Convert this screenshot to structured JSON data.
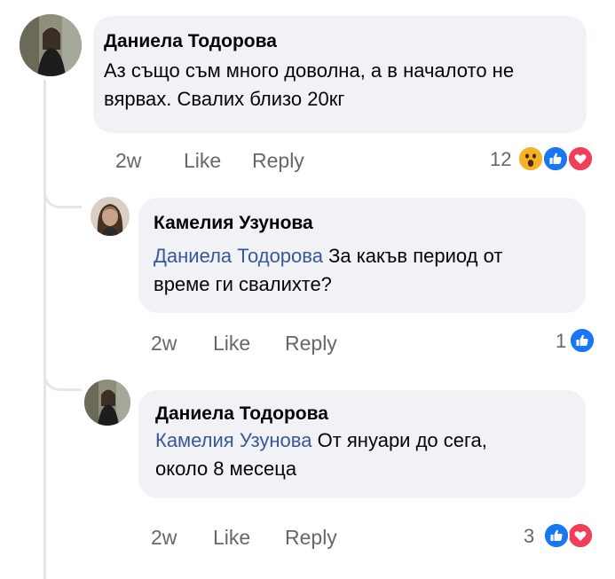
{
  "comments": [
    {
      "author": "Даниела Тодорова",
      "line1": "Аз също съм много доволна, а в началото не",
      "line2": "вярвах. Свалих близо 20кг",
      "time": "2w",
      "like_label": "Like",
      "reply_label": "Reply",
      "reaction_count": "12",
      "reactions": [
        "wow-icon",
        "like-icon",
        "love-icon"
      ]
    },
    {
      "author": "Камелия Узунова",
      "mention": "Даниела Тодорова",
      "line1_rest": " За какъв период от",
      "line2": "време ги свалихте?",
      "time": "2w",
      "like_label": "Like",
      "reply_label": "Reply",
      "reaction_count": "1",
      "reactions": [
        "like-icon"
      ]
    },
    {
      "author": "Даниела Тодорова",
      "mention": "Камелия Узунова",
      "line1_rest": " От януари до сега,",
      "line2": "около 8 месеца",
      "time": "2w",
      "like_label": "Like",
      "reply_label": "Reply",
      "reaction_count": "3",
      "reactions": [
        "like-icon",
        "love-icon"
      ]
    }
  ],
  "colors": {
    "bubble": "#f0f2f5",
    "mention": "#385898",
    "meta": "#65676b",
    "like": "#1877f2",
    "love": "#f33e58",
    "wow": "#f7b125"
  }
}
